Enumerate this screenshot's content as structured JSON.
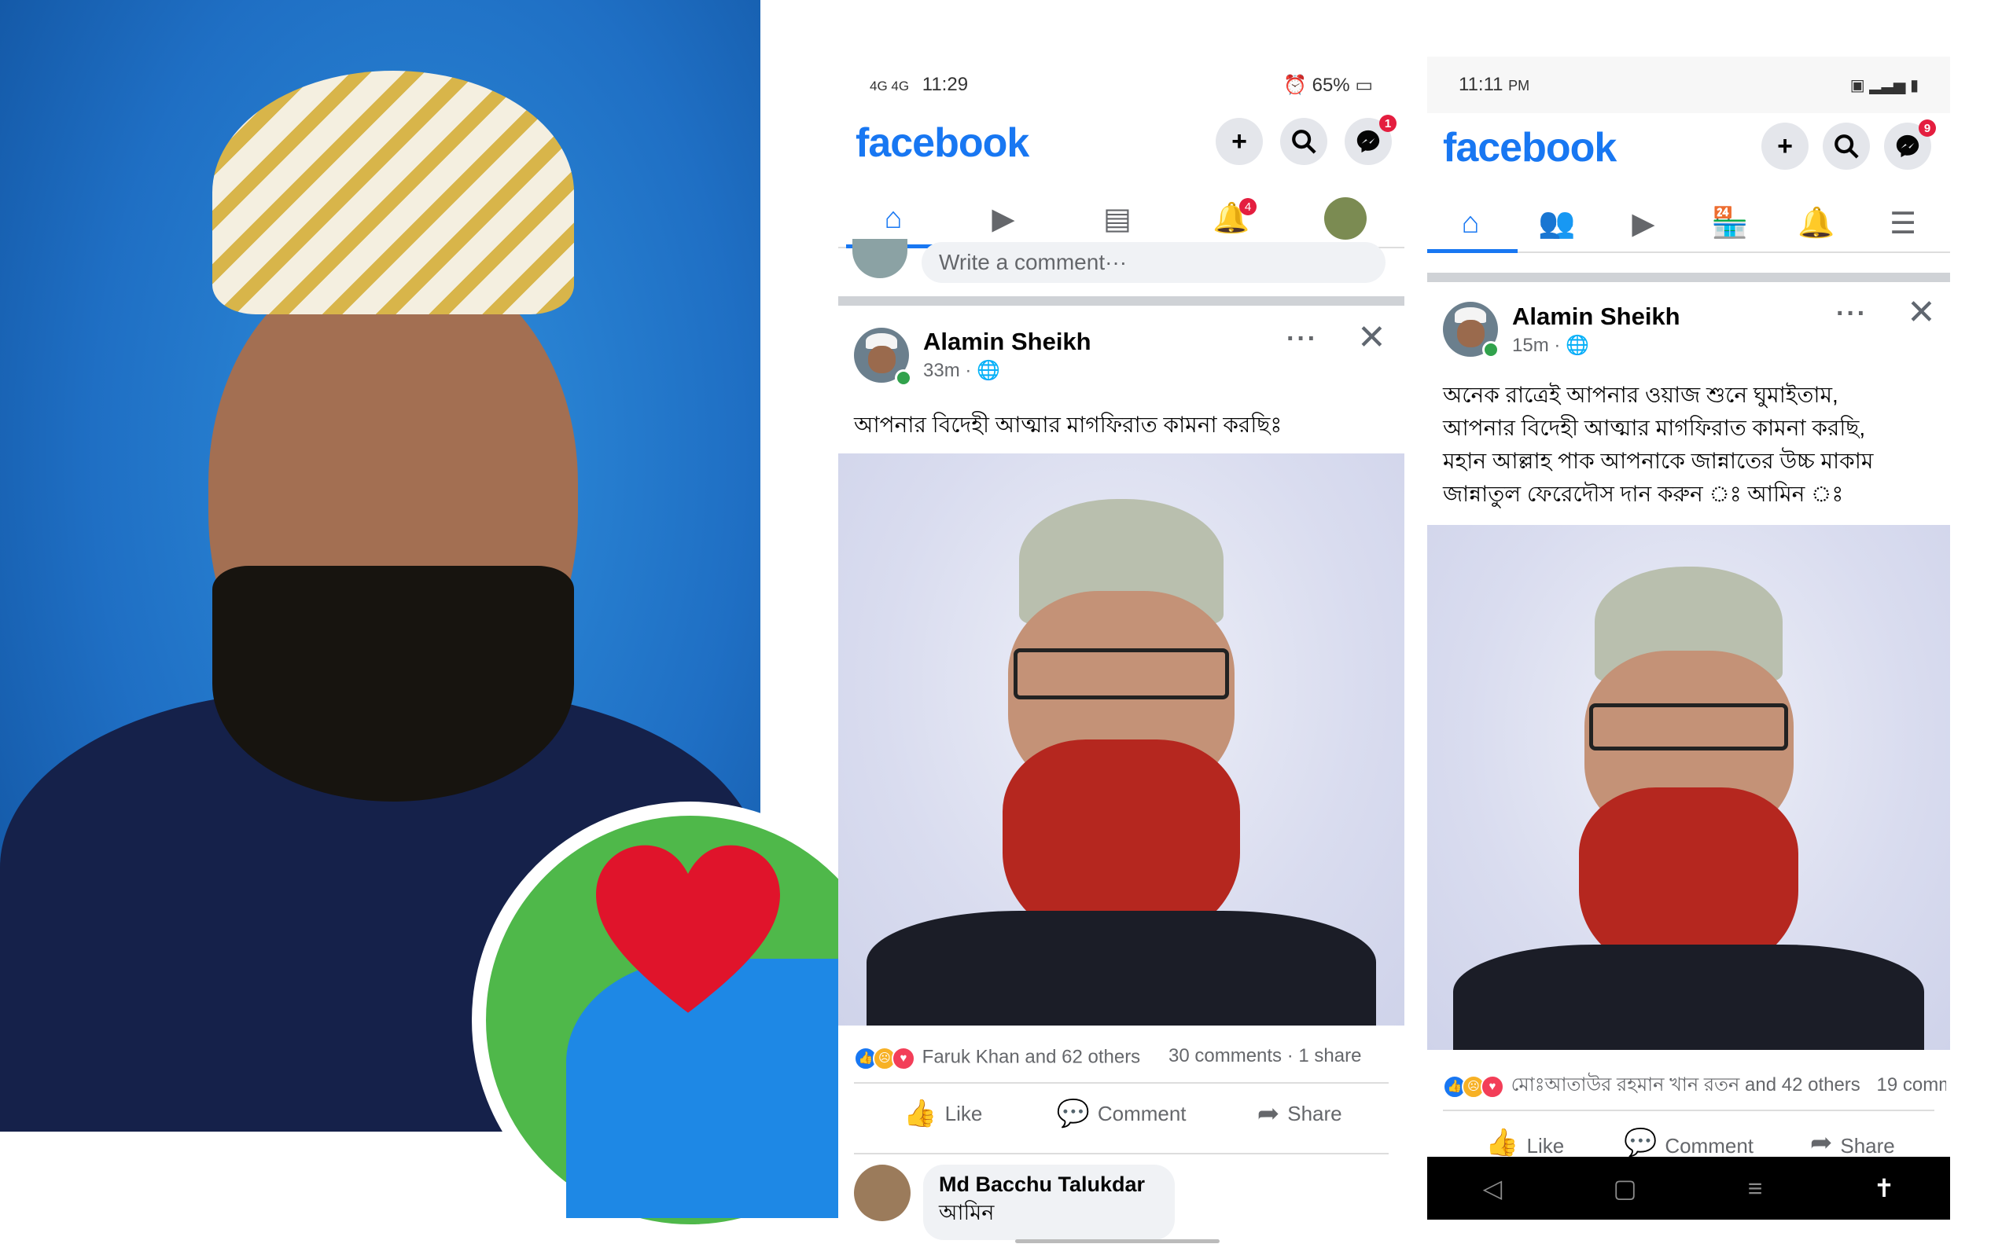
{
  "left": {
    "heart_icon": "heart-icon"
  },
  "phone1": {
    "status": {
      "network": "4G 4G",
      "time": "11:29",
      "battery": "65%"
    },
    "logo": "facebook",
    "messenger_badge": "1",
    "notifications_badge": "4",
    "write_comment_placeholder": "Write a comment···",
    "post": {
      "author": "Alamin Sheikh",
      "time": "33m",
      "text": "আপনার বিদেহী আত্মার মাগফিরাত কামনা করছিঃ",
      "reactions": "Faruk Khan and 62 others",
      "comments": "30 comments",
      "shares": "1 share"
    },
    "actions": {
      "like": "Like",
      "comment": "Comment",
      "share": "Share"
    },
    "comment": {
      "author": "Md Bacchu Talukdar",
      "text": "আমিন"
    }
  },
  "phone2": {
    "status": {
      "time": "11:11",
      "ampm": "PM"
    },
    "logo": "facebook",
    "messenger_badge": "9",
    "post": {
      "author": "Alamin Sheikh",
      "time": "15m",
      "text_lines": [
        "অনেক রাত্রেই আপনার ওয়াজ শুনে ঘুমাইতাম,",
        "আপনার বিদেহী আত্মার মাগফিরাত কামনা করছি,",
        "মহান আল্লাহ পাক আপনাকে জান্নাতের উচ্চ মাকাম",
        "জান্নাতুল ফেরেদৌস দান করুন ঃ আমিন ঃ"
      ],
      "reactions": "মোঃআতাউর রহমান খান রতন and 42 others",
      "comments": "19 comm"
    },
    "actions": {
      "like": "Like",
      "comment": "Comment",
      "share": "Share"
    }
  },
  "colors": {
    "facebook_blue": "#1877f2",
    "badge_red": "#e41e3f",
    "online_green": "#31a24c"
  }
}
